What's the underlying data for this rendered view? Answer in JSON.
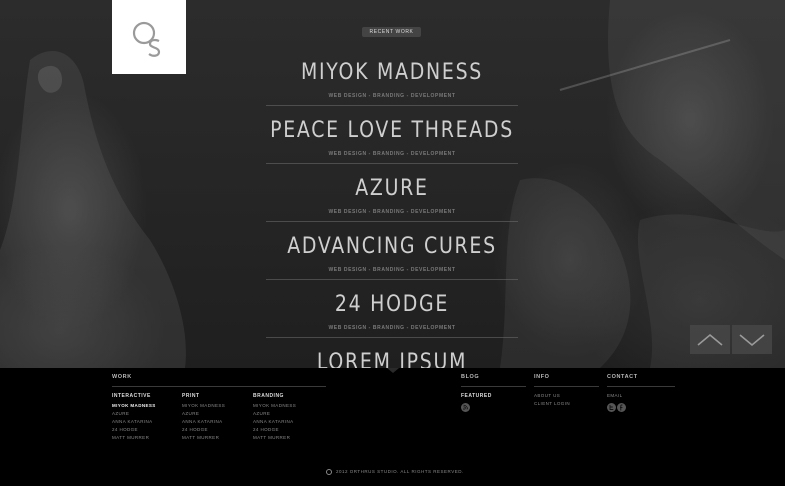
{
  "hero": {
    "badge": "RECENT WORK",
    "items": [
      {
        "title": "MIYOK MADNESS",
        "tags": "WEB DESIGN - BRANDING - DEVELOPMENT"
      },
      {
        "title": "PEACE LOVE THREADS",
        "tags": "WEB DESIGN - BRANDING - DEVELOPMENT"
      },
      {
        "title": "AZURE",
        "tags": "WEB DESIGN - BRANDING - DEVELOPMENT"
      },
      {
        "title": "ADVANCING CURES",
        "tags": "WEB DESIGN - BRANDING - DEVELOPMENT"
      },
      {
        "title": "24 HODGE",
        "tags": "WEB DESIGN - BRANDING - DEVELOPMENT"
      },
      {
        "title": "LOREM IPSUM",
        "tags": ""
      }
    ],
    "nav": {
      "up_icon": "chevron-up-icon",
      "down_icon": "chevron-down-icon"
    }
  },
  "logo": {
    "icon": "os-monogram-logo"
  },
  "footer": {
    "work": {
      "heading": "WORK",
      "columns": [
        {
          "heading": "INTERACTIVE",
          "links": [
            "MIYOK MADNESS",
            "AZURE",
            "ANNA KATARINA",
            "24 HODGE",
            "MATT MURRER"
          ],
          "active_index": 0
        },
        {
          "heading": "PRINT",
          "links": [
            "MIYOK MADNESS",
            "AZURE",
            "ANNA KATARINA",
            "24 HODGE",
            "MATT MURRER"
          ]
        },
        {
          "heading": "BRANDING",
          "links": [
            "MIYOK MADNESS",
            "AZURE",
            "ANNA KATARINA",
            "24 HODGE",
            "MATT MURRER"
          ]
        }
      ]
    },
    "blog": {
      "heading": "BLOG",
      "sub": "FEATURED",
      "icon": "rss-icon"
    },
    "info": {
      "heading": "INFO",
      "links": [
        "ABOUT US",
        "CLIENT LOGIN"
      ]
    },
    "contact": {
      "heading": "CONTACT",
      "links": [
        "EMAIL"
      ],
      "icons": [
        "twitter-icon",
        "facebook-icon"
      ]
    },
    "copyright": "2012 ORTHRUS STUDIO. ALL RIGHTS RESERVED."
  },
  "colors": {
    "background": "#000000",
    "hero_text": "#cfcfcf",
    "muted": "#7a7a7a",
    "accent": "#444444"
  }
}
